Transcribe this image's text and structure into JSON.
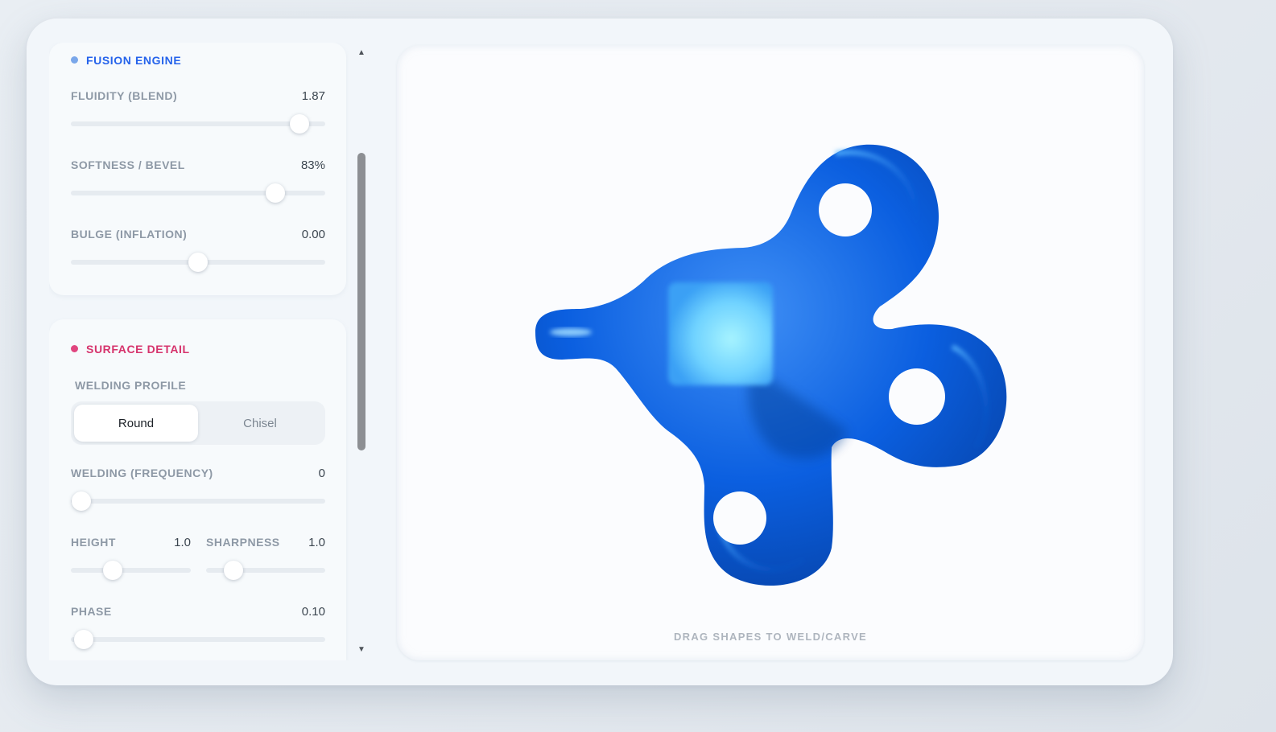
{
  "fusion_engine": {
    "title": "FUSION ENGINE",
    "dot_color": "#7aa7ea",
    "title_color": "#2563eb",
    "sliders": [
      {
        "label": "FLUIDITY (BLEND)",
        "value_text": "1.87",
        "level": 0.9
      },
      {
        "label": "SOFTNESS / BEVEL",
        "value_text": "83%",
        "level": 0.805
      },
      {
        "label": "BULGE (INFLATION)",
        "value_text": "0.00",
        "level": 0.5
      }
    ]
  },
  "surface_detail": {
    "title": "SURFACE DETAIL",
    "dot_color": "#e0457f",
    "title_color": "#d6336c",
    "profile_label": "WELDING PROFILE",
    "profile_options": [
      "Round",
      "Chisel"
    ],
    "profile_selected": "Round",
    "welding": {
      "label": "WELDING (FREQUENCY)",
      "value_text": "0",
      "level": 0.04
    },
    "height": {
      "label": "HEIGHT",
      "value_text": "1.0",
      "level": 0.35
    },
    "sharpness": {
      "label": "SHARPNESS",
      "value_text": "1.0",
      "level": 0.23
    },
    "phase": {
      "label": "PHASE",
      "value_text": "0.10",
      "level": 0.05
    }
  },
  "viewport": {
    "hint": "DRAG SHAPES TO WELD/CARVE",
    "shape_color": "#0b5fe0"
  }
}
